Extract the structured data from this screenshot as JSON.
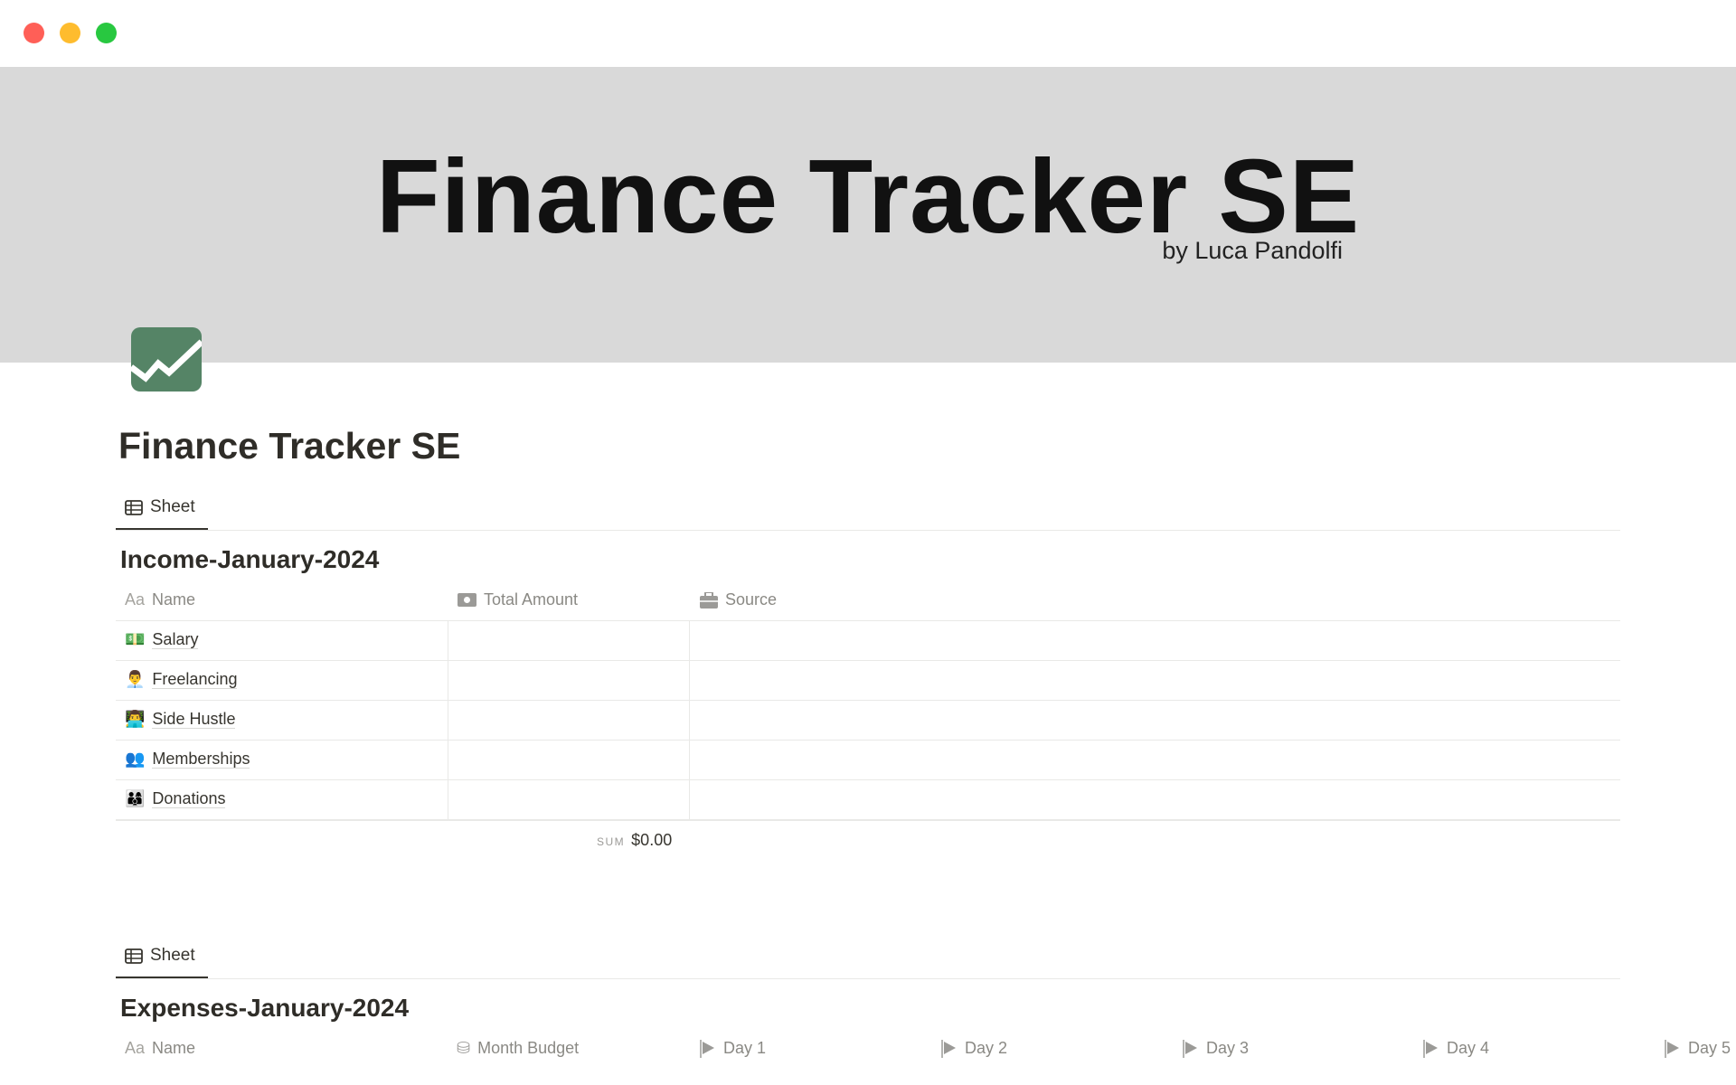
{
  "window": {
    "controls": {
      "close": "#ff5f57",
      "minimize": "#febc2e",
      "maximize": "#28c840"
    }
  },
  "banner": {
    "title": "Finance Tracker SE",
    "subtitle": "by Luca Pandolfi",
    "background": "#d9d9d9"
  },
  "page": {
    "icon": "chart-trend-icon",
    "icon_color": "#558466",
    "title": "Finance Tracker SE"
  },
  "income": {
    "tab": "Sheet",
    "title": "Income-January-2024",
    "columns": [
      {
        "label": "Name",
        "icon": "Aa"
      },
      {
        "label": "Total Amount",
        "icon": "money-icon"
      },
      {
        "label": "Source",
        "icon": "briefcase-icon"
      }
    ],
    "rows": [
      {
        "emoji": "💵",
        "name": "Salary"
      },
      {
        "emoji": "👨‍💼",
        "name": "Freelancing"
      },
      {
        "emoji": "👨‍💻",
        "name": "Side Hustle"
      },
      {
        "emoji": "👥",
        "name": "Memberships"
      },
      {
        "emoji": "👨‍👩‍👦",
        "name": "Donations"
      }
    ],
    "sum_label": "SUM",
    "sum_value": "$0.00"
  },
  "expenses": {
    "tab": "Sheet",
    "title": "Expenses-January-2024",
    "columns": [
      {
        "label": "Name",
        "icon": "Aa"
      },
      {
        "label": "Month Budget",
        "icon": "coins-icon"
      },
      {
        "label": "Day 1",
        "icon": "flag-icon"
      },
      {
        "label": "Day 2",
        "icon": "flag-icon"
      },
      {
        "label": "Day 3",
        "icon": "flag-icon"
      },
      {
        "label": "Day 4",
        "icon": "flag-icon"
      },
      {
        "label": "Day 5",
        "icon": "flag-icon"
      }
    ]
  }
}
